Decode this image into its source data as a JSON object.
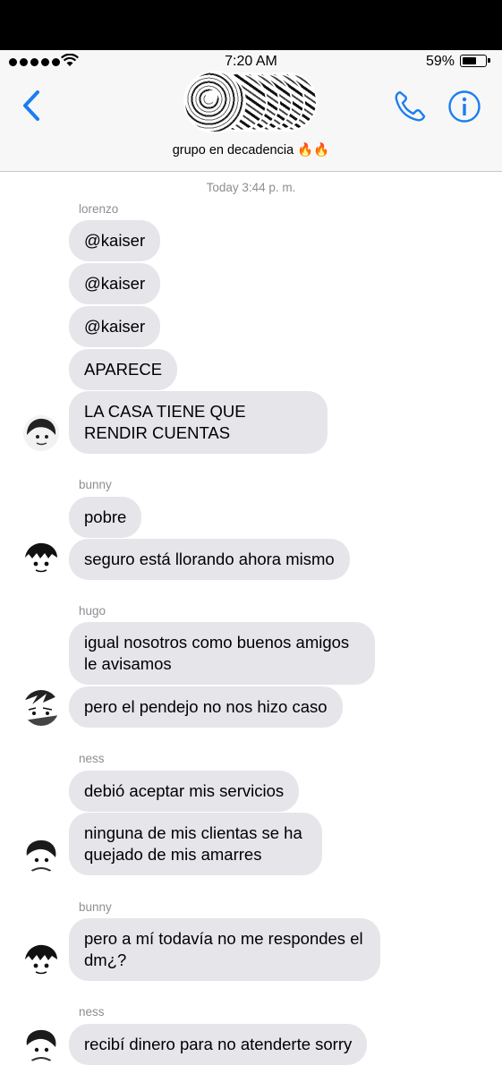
{
  "status_bar": {
    "time": "7:20 AM",
    "battery_percent": "59%",
    "signal_bars": 5,
    "battery_level": 0.59
  },
  "header": {
    "group_name": "grupo en decadencia 🔥🔥",
    "back_icon": "chevron-left-icon",
    "call_icon": "phone-icon",
    "info_icon": "info-icon",
    "accent_color": "#1a7ef0"
  },
  "conversation": {
    "timestamp": "Today 3:44 p. m.",
    "bubble_color": "#e5e5ea",
    "groups": [
      {
        "sender": "lorenzo",
        "messages": [
          "@kaiser",
          "@kaiser",
          "@kaiser",
          "APARECE",
          "LA CASA TIENE QUE RENDIR CUENTAS"
        ]
      },
      {
        "sender": "bunny",
        "messages": [
          "pobre",
          "seguro está llorando ahora mismo"
        ]
      },
      {
        "sender": "hugo",
        "messages": [
          "igual nosotros como buenos amigos le avisamos",
          "pero el pendejo no nos hizo caso"
        ]
      },
      {
        "sender": "ness",
        "messages": [
          "debió aceptar mis servicios",
          "ninguna de mis clientas se ha quejado de mis amarres"
        ]
      },
      {
        "sender": "bunny",
        "messages": [
          "pero a mí todavía no me respondes el dm¿?"
        ]
      },
      {
        "sender": "ness",
        "messages": [
          "recibí dinero para no atenderte sorry"
        ]
      }
    ]
  }
}
